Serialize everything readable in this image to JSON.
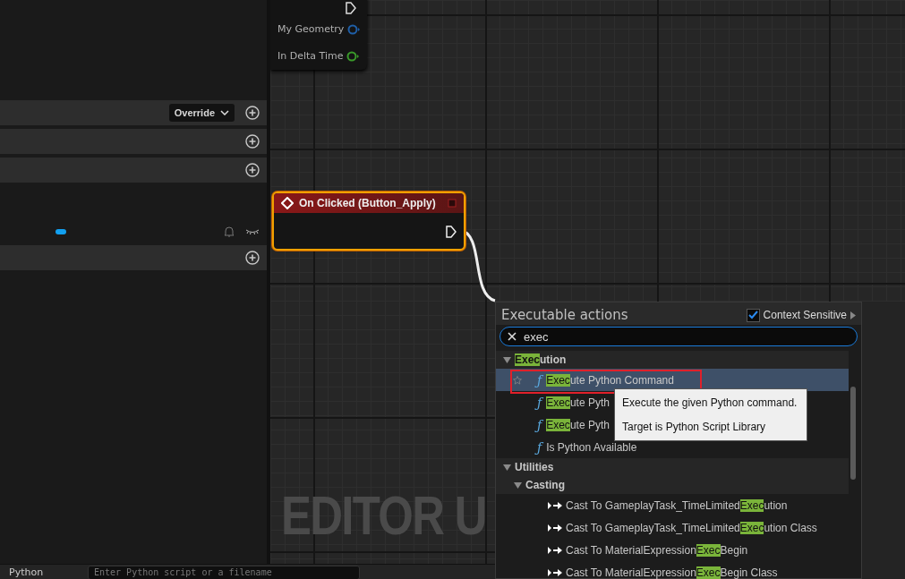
{
  "details_panel": {
    "rows": [
      {
        "kind": "dropdown",
        "button": "Override"
      },
      {
        "kind": "plain"
      },
      {
        "kind": "plain"
      },
      {
        "kind": "gap"
      },
      {
        "kind": "visibility"
      },
      {
        "kind": "plain"
      }
    ]
  },
  "graph": {
    "background_label": "EDITOR U",
    "tick_node": {
      "pins": [
        {
          "label": "My Geometry",
          "color": "#1f5fa8"
        },
        {
          "label": "In Delta Time",
          "color": "#3a9a2a"
        }
      ]
    },
    "event_node": {
      "title": "On Clicked (Button_Apply)",
      "selected": true
    }
  },
  "action_menu": {
    "title": "Executable actions",
    "context_sensitive": {
      "label": "Context Sensitive",
      "checked": true
    },
    "search": {
      "value": "exec"
    },
    "items": [
      {
        "kind": "category",
        "expanded": true,
        "parts": [
          {
            "text": "Exec",
            "match": true
          },
          {
            "text": "ution",
            "match": false
          }
        ],
        "children": [
          {
            "kind": "function",
            "icon": "ƒ",
            "selected": true,
            "outlined": true,
            "parts": [
              {
                "text": "Exec",
                "match": true
              },
              {
                "text": "ute Python Command",
                "match": false
              }
            ]
          },
          {
            "kind": "function",
            "icon": "ƒ",
            "selected": false,
            "outlined": false,
            "parts": [
              {
                "text": "Exec",
                "match": true
              },
              {
                "text": "ute Pyth",
                "match": false
              }
            ]
          },
          {
            "kind": "function",
            "icon": "ƒ",
            "selected": false,
            "outlined": false,
            "parts": [
              {
                "text": "Exec",
                "match": true
              },
              {
                "text": "ute Pyth",
                "match": false
              }
            ]
          },
          {
            "kind": "function",
            "icon": "ƒ",
            "selected": false,
            "outlined": false,
            "parts": [
              {
                "text": "Is Python Available",
                "match": false
              }
            ]
          }
        ]
      },
      {
        "kind": "category",
        "expanded": true,
        "parts": [
          {
            "text": "Utilities",
            "match": false
          }
        ],
        "children": [
          {
            "kind": "category",
            "expanded": true,
            "parts": [
              {
                "text": "Casting",
                "match": false
              }
            ],
            "children": [
              {
                "kind": "cast",
                "selected": false,
                "outlined": false,
                "parts": [
                  {
                    "text": "Cast To GameplayTask_TimeLimited",
                    "match": false
                  },
                  {
                    "text": "Exec",
                    "match": true
                  },
                  {
                    "text": "ution",
                    "match": false
                  }
                ]
              },
              {
                "kind": "cast",
                "selected": false,
                "outlined": false,
                "parts": [
                  {
                    "text": "Cast To GameplayTask_TimeLimited",
                    "match": false
                  },
                  {
                    "text": "Exec",
                    "match": true
                  },
                  {
                    "text": "ution Class",
                    "match": false
                  }
                ]
              },
              {
                "kind": "cast",
                "selected": false,
                "outlined": false,
                "parts": [
                  {
                    "text": "Cast To MaterialExpression",
                    "match": false
                  },
                  {
                    "text": "Exec",
                    "match": true
                  },
                  {
                    "text": "Begin",
                    "match": false
                  }
                ]
              },
              {
                "kind": "cast",
                "selected": false,
                "outlined": false,
                "parts": [
                  {
                    "text": "Cast To MaterialExpression",
                    "match": false
                  },
                  {
                    "text": "Exec",
                    "match": true
                  },
                  {
                    "text": "Begin Class",
                    "match": false
                  }
                ]
              }
            ]
          }
        ]
      }
    ],
    "tooltip": {
      "lines": [
        "Execute the given Python command.",
        "Target is Python Script Library"
      ]
    }
  },
  "console_bar": {
    "label": "Python",
    "placeholder": "Enter Python script or a filename"
  }
}
